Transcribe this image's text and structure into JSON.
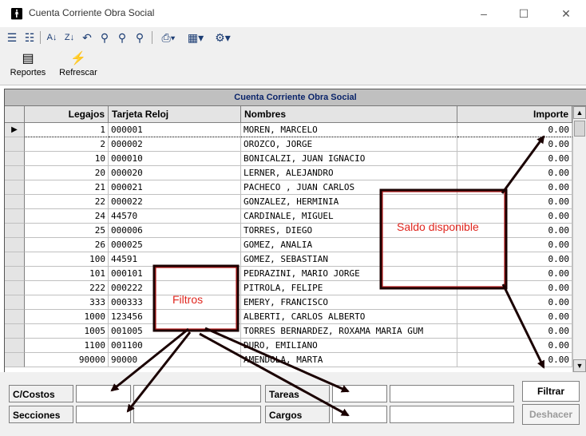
{
  "window": {
    "app_icon": "person-icon",
    "title": "Cuenta Corriente Obra Social",
    "minimize": "–",
    "maximize": "☐",
    "close": "✕"
  },
  "toolbar": {
    "icons": [
      "indent-icon",
      "outdent-icon",
      "sort-asc-icon",
      "sort-desc-icon",
      "undo-icon",
      "find-icon",
      "find-next-icon",
      "find-prev-icon",
      "print-icon",
      "excel-icon",
      "settings-icon"
    ]
  },
  "ribbon": {
    "reportes": "Reportes",
    "refrescar": "Refrescar"
  },
  "grid": {
    "caption": "Cuenta Corriente Obra Social",
    "columns": {
      "legajos": "Legajos",
      "tarjeta": "Tarjeta Reloj",
      "nombres": "Nombres",
      "importe": "Importe"
    },
    "rows": [
      {
        "legajo": "1",
        "tarjeta": "000001",
        "nombre": "MOREN, MARCELO",
        "importe": "0.00"
      },
      {
        "legajo": "2",
        "tarjeta": "000002",
        "nombre": "OROZCO, JORGE",
        "importe": "0.00"
      },
      {
        "legajo": "10",
        "tarjeta": "000010",
        "nombre": "BONICALZI, JUAN IGNACIO",
        "importe": "0.00"
      },
      {
        "legajo": "20",
        "tarjeta": "000020",
        "nombre": "LERNER, ALEJANDRO",
        "importe": "0.00"
      },
      {
        "legajo": "21",
        "tarjeta": "000021",
        "nombre": "PACHECO , JUAN CARLOS",
        "importe": "0.00"
      },
      {
        "legajo": "22",
        "tarjeta": "000022",
        "nombre": "GONZALEZ, HERMINIA",
        "importe": "0.00"
      },
      {
        "legajo": "24",
        "tarjeta": "44570",
        "nombre": "CARDINALE, MIGUEL",
        "importe": "0.00"
      },
      {
        "legajo": "25",
        "tarjeta": "000006",
        "nombre": "TORRES, DIEGO",
        "importe": "0.00"
      },
      {
        "legajo": "26",
        "tarjeta": "000025",
        "nombre": "GOMEZ, ANALIA",
        "importe": "0.00"
      },
      {
        "legajo": "100",
        "tarjeta": "44591",
        "nombre": "GOMEZ, SEBASTIAN",
        "importe": "0.00"
      },
      {
        "legajo": "101",
        "tarjeta": "000101",
        "nombre": "PEDRAZINI, MARIO JORGE",
        "importe": "0.00"
      },
      {
        "legajo": "222",
        "tarjeta": "000222",
        "nombre": "PITROLA, FELIPE",
        "importe": "0.00"
      },
      {
        "legajo": "333",
        "tarjeta": "000333",
        "nombre": "EMERY, FRANCISCO",
        "importe": "0.00"
      },
      {
        "legajo": "1000",
        "tarjeta": "123456",
        "nombre": "ALBERTI, CARLOS ALBERTO",
        "importe": "0.00"
      },
      {
        "legajo": "1005",
        "tarjeta": "001005",
        "nombre": "TORRES BERNARDEZ, ROXAMA MARIA GUM",
        "importe": "0.00"
      },
      {
        "legajo": "1100",
        "tarjeta": "001100",
        "nombre": "DURO, EMILIANO",
        "importe": "0.00"
      },
      {
        "legajo": "90000",
        "tarjeta": "90000",
        "nombre": "AMENDOLA, MARTA",
        "importe": "0.00"
      }
    ]
  },
  "filters": {
    "ccostos": "C/Costos",
    "secciones": "Secciones",
    "tareas": "Tareas",
    "cargos": "Cargos",
    "filtrar": "Filtrar",
    "deshacer": "Deshacer"
  },
  "annotations": {
    "saldo": "Saldo disponible",
    "filtros": "Filtros",
    "color": "#e0261e"
  }
}
